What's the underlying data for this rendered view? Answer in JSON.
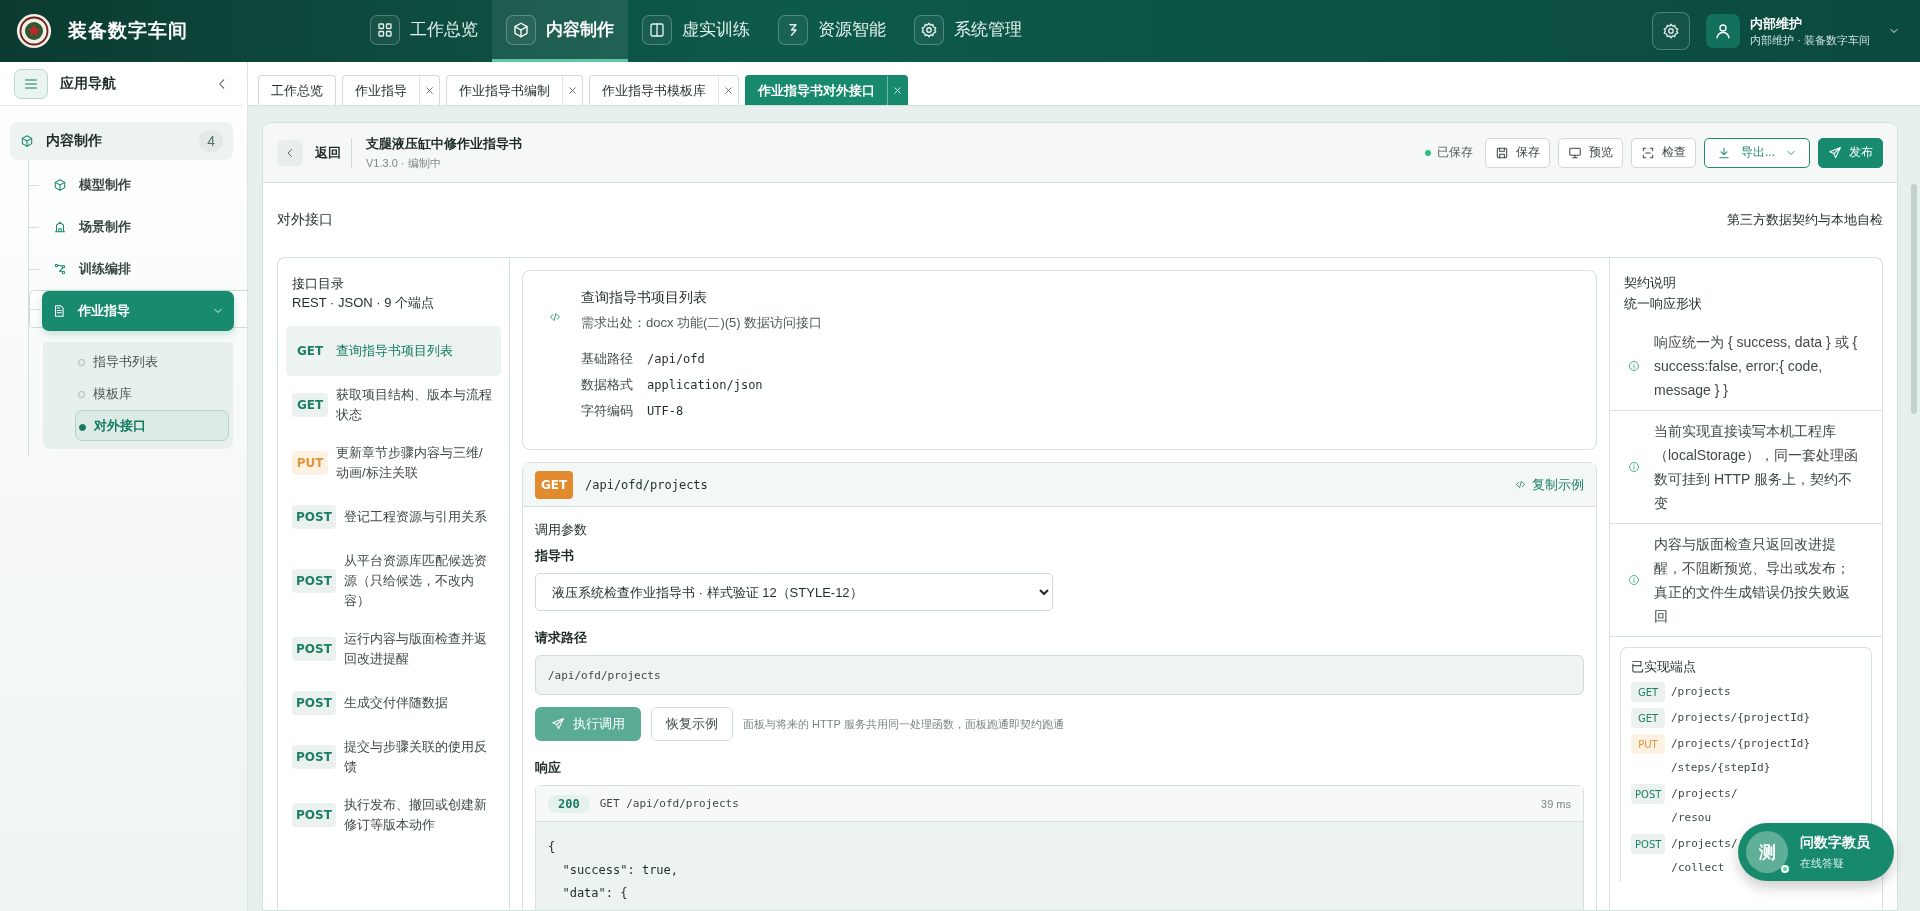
{
  "app": {
    "title": "装备数字车间"
  },
  "top_nav": [
    {
      "label": "工作总览",
      "selected": false
    },
    {
      "label": "内容制作",
      "selected": true
    },
    {
      "label": "虚实训练",
      "selected": false
    },
    {
      "label": "资源智能",
      "selected": false
    },
    {
      "label": "系统管理",
      "selected": false
    }
  ],
  "user": {
    "name": "内部维护",
    "subtitle": "内部维护 · 装备数字车间"
  },
  "sidebar": {
    "title": "应用导航",
    "group": {
      "label": "内容制作",
      "badge": "4",
      "items": [
        {
          "label": "模型制作",
          "selected": false
        },
        {
          "label": "场景制作",
          "selected": false
        },
        {
          "label": "训练编排",
          "selected": false
        },
        {
          "label": "作业指导",
          "selected": true,
          "expanded": true,
          "children": [
            {
              "label": "指导书列表",
              "selected": false
            },
            {
              "label": "模板库",
              "selected": false
            },
            {
              "label": "对外接口",
              "selected": true
            }
          ]
        }
      ]
    }
  },
  "tabs": [
    {
      "label": "工作总览",
      "closable": false,
      "selected": false
    },
    {
      "label": "作业指导",
      "closable": true,
      "selected": false
    },
    {
      "label": "作业指导书编制",
      "closable": true,
      "selected": false
    },
    {
      "label": "作业指导书模板库",
      "closable": true,
      "selected": false
    },
    {
      "label": "作业指导书对外接口",
      "closable": true,
      "selected": true
    }
  ],
  "document": {
    "back": "返回",
    "title": "支腿液压缸中修作业指导书",
    "meta": "V1.3.0 · 编制中",
    "save_status": "已保存",
    "actions": [
      {
        "label": "保存",
        "kind": "plain"
      },
      {
        "label": "预览",
        "kind": "plain"
      },
      {
        "label": "检查",
        "kind": "plain"
      },
      {
        "label": "导出...",
        "kind": "dropdown"
      },
      {
        "label": "发布",
        "kind": "primary"
      }
    ]
  },
  "section": {
    "title": "对外接口",
    "subtitle": "第三方数据契约与本地自检"
  },
  "catalog": {
    "title": "接口目录",
    "summary": "REST · JSON · 9 个端点",
    "endpoints": [
      {
        "method": "GET",
        "label": "查询指导书项目列表",
        "selected": true
      },
      {
        "method": "GET",
        "label": "获取项目结构、版本与流程状态",
        "selected": false
      },
      {
        "method": "PUT",
        "label": "更新章节步骤内容与三维/动画/标注关联",
        "selected": false
      },
      {
        "method": "POST",
        "label": "登记工程资源与引用关系",
        "selected": false
      },
      {
        "method": "POST",
        "label": "从平台资源库匹配候选资源（只给候选，不改内容）",
        "selected": false
      },
      {
        "method": "POST",
        "label": "运行内容与版面检查并返回改进提醒",
        "selected": false
      },
      {
        "method": "POST",
        "label": "生成交付伴随数据",
        "selected": false
      },
      {
        "method": "POST",
        "label": "提交与步骤关联的使用反馈",
        "selected": false
      },
      {
        "method": "POST",
        "label": "执行发布、撤回或创建新修订等版本动作",
        "selected": false
      }
    ]
  },
  "interface_info": {
    "title": "查询指导书项目列表",
    "source": "需求出处：docx 功能(二)(5) 数据访问接口",
    "fields": [
      {
        "label": "基础路径",
        "value": "/api/ofd"
      },
      {
        "label": "数据格式",
        "value": "application/json"
      },
      {
        "label": "字符编码",
        "value": "UTF-8"
      }
    ]
  },
  "request": {
    "method": "GET",
    "path": "/api/ofd/projects",
    "copy_label": "复制示例",
    "params_title": "调用参数",
    "select_label": "指导书",
    "select_value": "液压系统检查作业指导书 · 样式验证 12（STYLE-12）",
    "path_label": "请求路径",
    "path_value": "/api/ofd/projects",
    "run_label": "执行调用",
    "reset_label": "恢复示例",
    "hint": "面板与将来的 HTTP 服务共用同一处理函数，面板跑通即契约跑通"
  },
  "response": {
    "title": "响应",
    "status": "200",
    "request_line": "GET /api/ofd/projects",
    "duration": "39 ms",
    "body_lines": [
      "{",
      "  \"success\": true,",
      "  \"data\": {"
    ]
  },
  "contract": {
    "title": "契约说明",
    "subtitle": "统一响应形状",
    "notes": [
      "响应统一为 { success, data } 或 { success:false, error:{ code, message } }",
      "当前实现直接读写本机工程库（localStorage），同一套处理函数可挂到 HTTP 服务上，契约不变",
      "内容与版面检查只返回改进提醒，不阻断预览、导出或发布；真正的文件生成错误仍按失败返回"
    ],
    "implemented_title": "已实现端点",
    "implemented": [
      {
        "method": "GET",
        "lines": [
          "/projects"
        ]
      },
      {
        "method": "GET",
        "lines": [
          "/projects/{projectId}"
        ]
      },
      {
        "method": "PUT",
        "lines": [
          "/projects/{projectId}",
          "/steps/{stepId}"
        ]
      },
      {
        "method": "POST",
        "lines": [
          "/projects/",
          "/resou"
        ]
      },
      {
        "method": "POST",
        "lines": [
          "/projects/",
          "/collect"
        ]
      }
    ]
  },
  "assistant": {
    "avatar": "测",
    "title": "问数字教员",
    "subtitle": "在线答疑",
    "online": true
  }
}
